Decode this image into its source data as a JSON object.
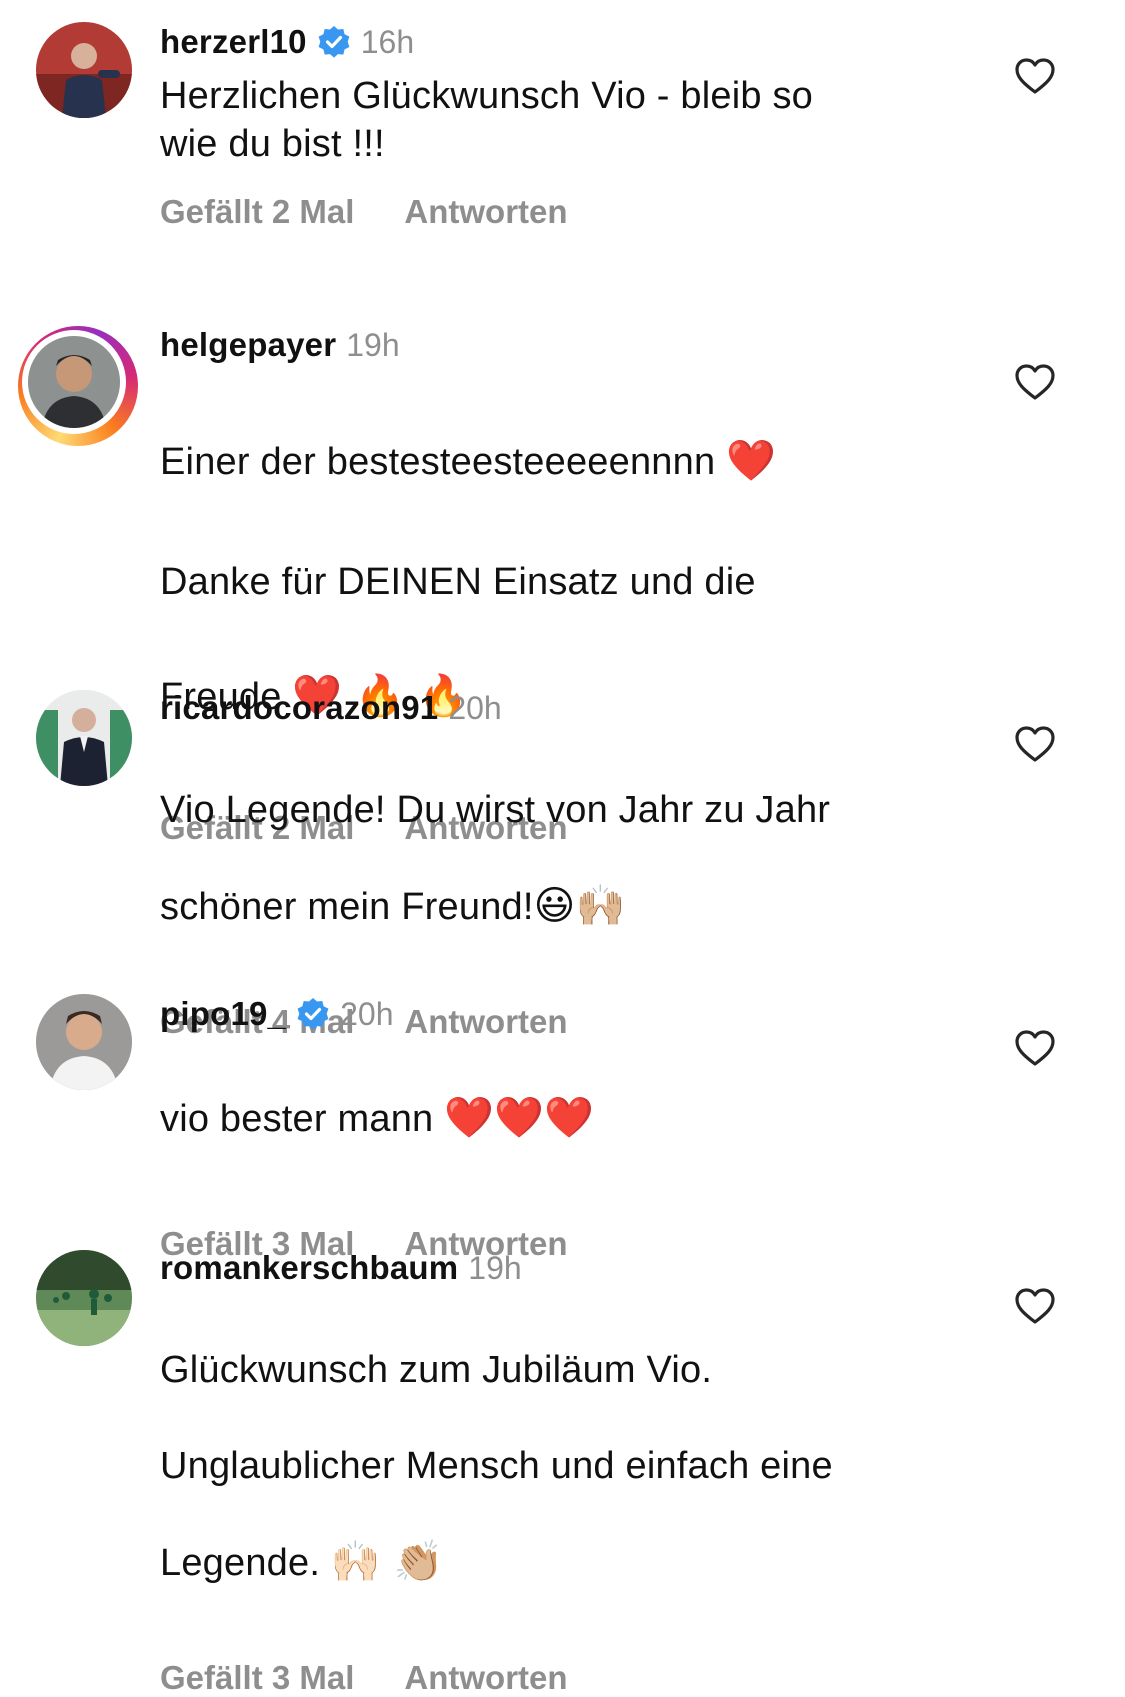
{
  "comments": [
    {
      "username": "herzerl10",
      "verified": true,
      "time": "16h",
      "text": "Herzlichen Glückwunsch Vio - bleib so\nwie du bist !!!",
      "likes": "Gefällt 2 Mal",
      "reply": "Antworten"
    },
    {
      "username": "helgepayer",
      "verified": false,
      "story_ring": true,
      "time": "19h",
      "text_line1": "Einer der bestesteesteeeeennnn ",
      "text_line1_emoji": "❤️",
      "text_line2": "Danke für DEINEN Einsatz und die",
      "text_line3": "Freude ",
      "text_line3_emoji": "❤️ 🔥 🔥",
      "likes": "Gefällt 2 Mal",
      "reply": "Antworten"
    },
    {
      "username": "ricardocorazon91",
      "verified": false,
      "time": "20h",
      "text_line1": "Vio Legende! Du wirst von Jahr zu Jahr",
      "text_line2": "schöner mein Freund!",
      "text_line2_emoji": "😃🙌🏼",
      "likes": "Gefällt 4 Mal",
      "reply": "Antworten"
    },
    {
      "username": "pipo19_",
      "verified": true,
      "time": "20h",
      "text_line1": "vio bester mann ",
      "text_line1_emoji": "❤️❤️❤️",
      "likes": "Gefällt 3 Mal",
      "reply": "Antworten"
    },
    {
      "username": "romankerschbaum",
      "verified": false,
      "time": "19h",
      "text_line1": "Glückwunsch zum Jubiläum Vio.",
      "text_line2": "Unglaublicher Mensch und einfach eine",
      "text_line3": "Legende. ",
      "text_line3_emoji": "🙌🏻 👏🏼",
      "likes": "Gefällt 3 Mal",
      "reply": "Antworten"
    }
  ],
  "colors": {
    "verified_blue": "#3897f0",
    "secondary_text": "#8e8e8e",
    "primary_text": "#111111"
  },
  "icons": {
    "like": "heart-outline-icon",
    "verified": "verified-badge-icon"
  }
}
